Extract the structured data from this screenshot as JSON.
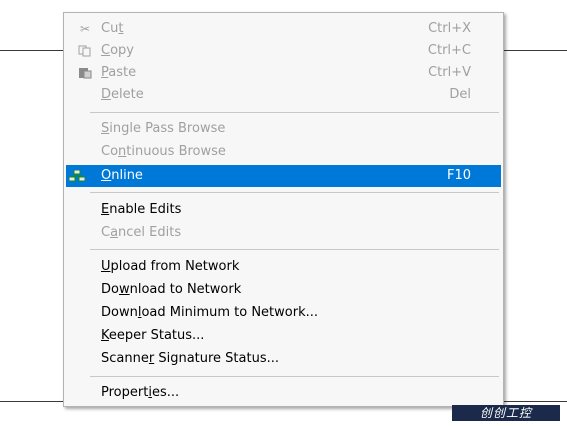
{
  "menu": {
    "items": [
      {
        "pre": "Cu",
        "acc": "t",
        "post": "",
        "shortcut": "Ctrl+X",
        "icon": "scissors-icon"
      },
      {
        "pre": "",
        "acc": "C",
        "post": "opy",
        "shortcut": "Ctrl+C",
        "icon": "copy-icon"
      },
      {
        "pre": "",
        "acc": "P",
        "post": "aste",
        "shortcut": "Ctrl+V",
        "icon": "paste-icon"
      },
      {
        "pre": "",
        "acc": "D",
        "post": "elete",
        "shortcut": "Del"
      },
      {
        "pre": "",
        "acc": "S",
        "post": "ingle Pass Browse"
      },
      {
        "pre": "Co",
        "acc": "n",
        "post": "tinuous Browse"
      },
      {
        "pre": "",
        "acc": "O",
        "post": "nline",
        "shortcut": "F10",
        "icon": "network-icon"
      },
      {
        "pre": "",
        "acc": "E",
        "post": "nable Edits"
      },
      {
        "pre": "C",
        "acc": "a",
        "post": "ncel Edits"
      },
      {
        "pre": "",
        "acc": "U",
        "post": "pload from Network"
      },
      {
        "pre": "Do",
        "acc": "w",
        "post": "nload to Network"
      },
      {
        "pre": "Down",
        "acc": "l",
        "post": "oad Minimum to Network..."
      },
      {
        "pre": "",
        "acc": "K",
        "post": "eeper Status..."
      },
      {
        "pre": "Scanne",
        "acc": "r",
        "post": " Signature Status..."
      },
      {
        "pre": "Propert",
        "acc": "i",
        "post": "es..."
      }
    ]
  },
  "watermark": {
    "text": "创创工控"
  },
  "colors": {
    "highlight": "#0078d7",
    "disabled_text": "#a0a0a0"
  }
}
